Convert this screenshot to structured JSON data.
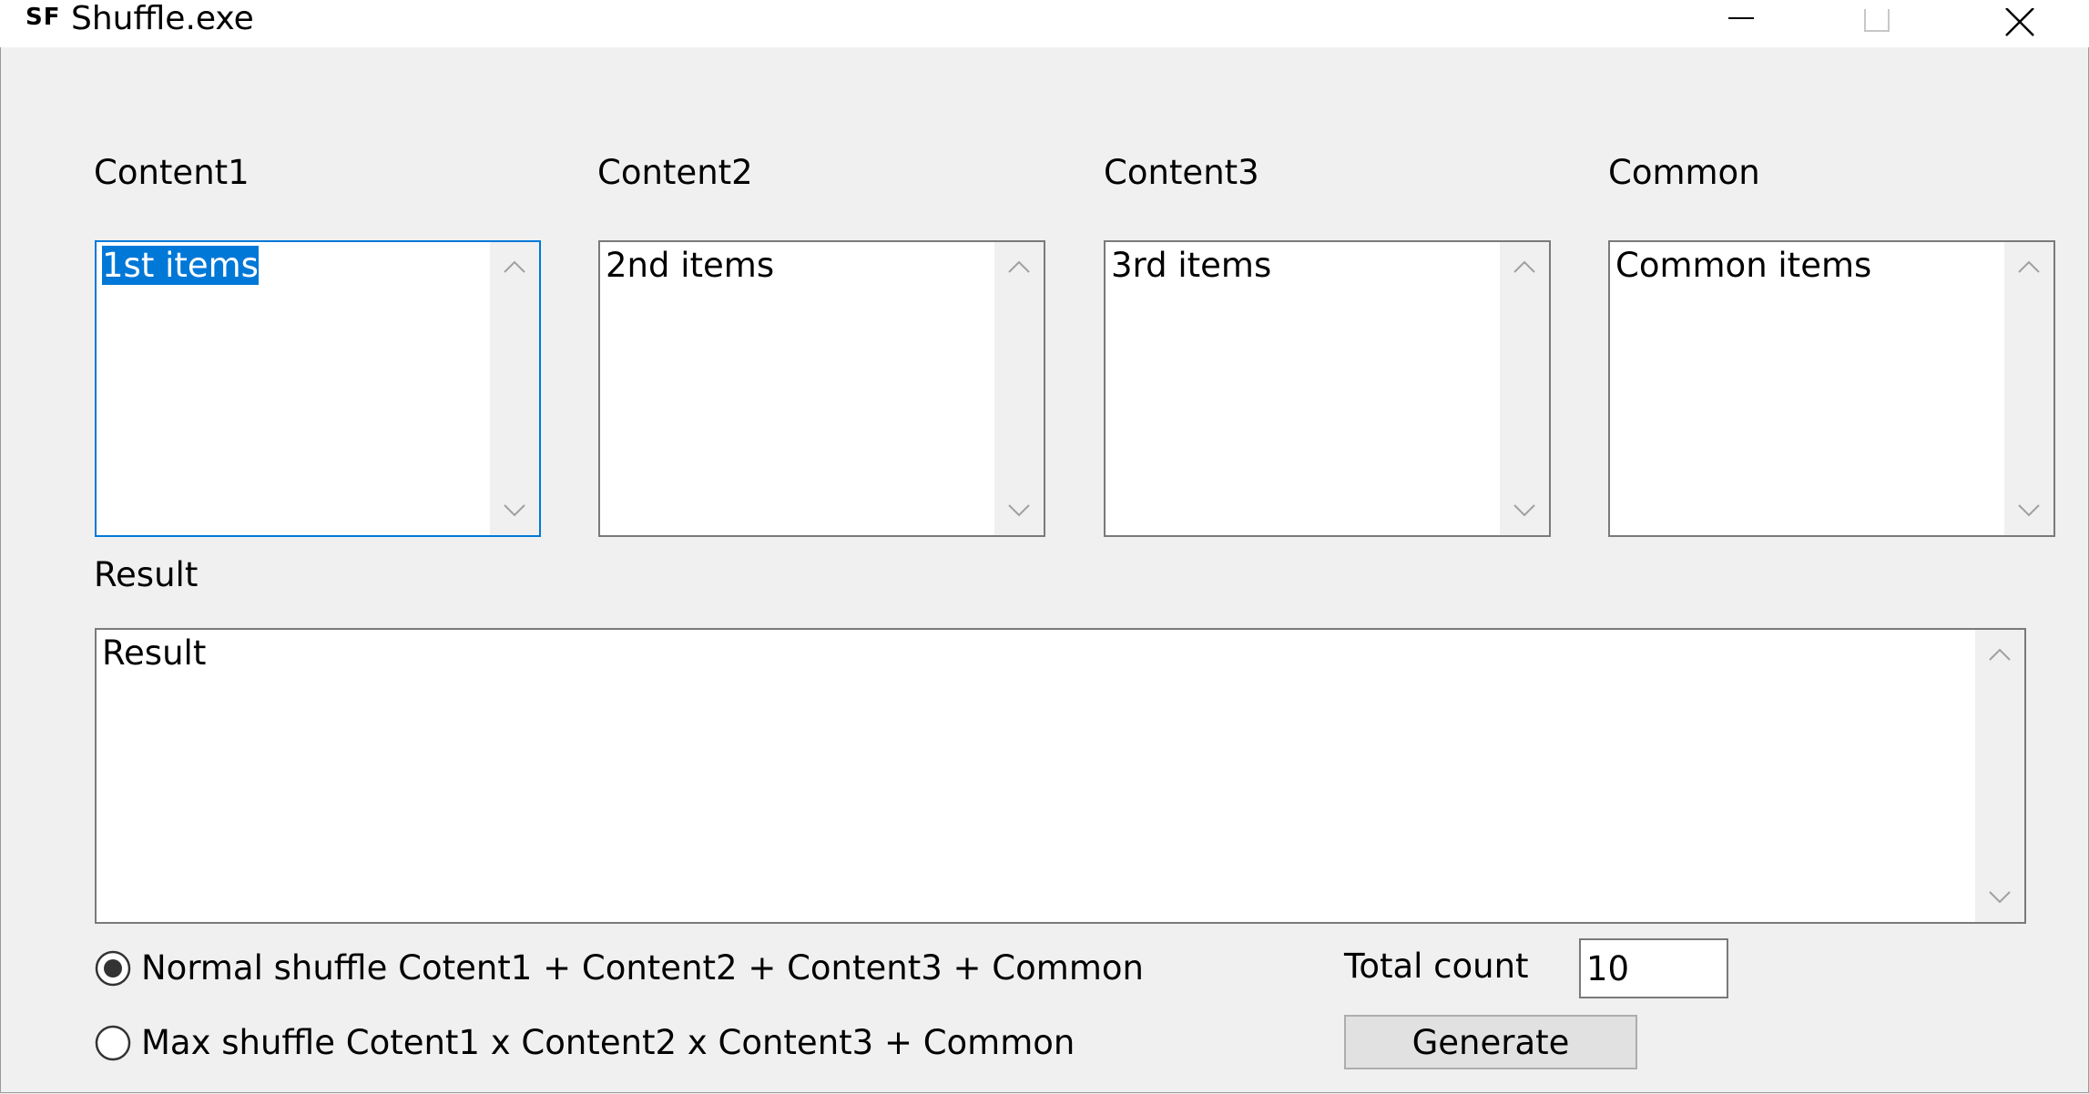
{
  "window": {
    "icon_text": "SF",
    "title": "Shuffle.exe",
    "minimize_icon": "minimize-icon",
    "maximize_icon": "maximize-icon",
    "close_icon": "close-icon"
  },
  "inputs": {
    "content1": {
      "label": "Content1",
      "value": "1st items"
    },
    "content2": {
      "label": "Content2",
      "value": "2nd items"
    },
    "content3": {
      "label": "Content3",
      "value": "3rd items"
    },
    "common": {
      "label": "Common",
      "value": "Common items"
    }
  },
  "result": {
    "label": "Result",
    "value": "Result"
  },
  "mode": {
    "normal_label": "Normal shuffle Cotent1 + Content2 +  Content3 + Common",
    "max_label": "Max shuffle Cotent1 x Content2 x Content3 + Common",
    "selected": "normal"
  },
  "total_count": {
    "label": "Total count",
    "value": "10"
  },
  "generate_label": "Generate",
  "colors": {
    "accent": "#0078d7",
    "background": "#f0f0f0"
  }
}
